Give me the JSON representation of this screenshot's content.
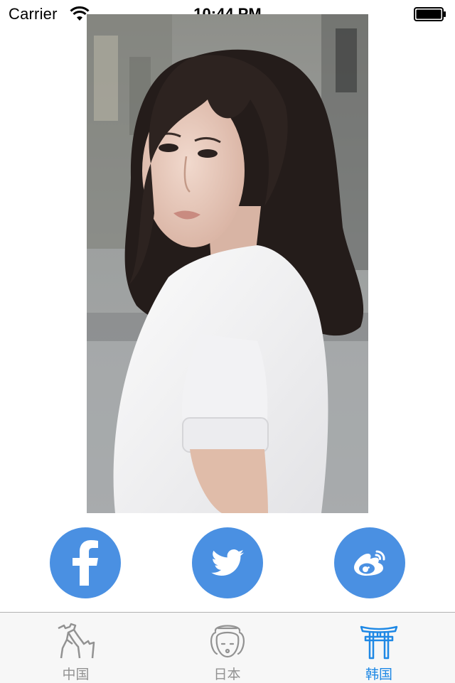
{
  "status_bar": {
    "carrier": "Carrier",
    "time": "10:44 PM"
  },
  "photo": {
    "icon": "portrait-photo"
  },
  "share_buttons": [
    {
      "icon": "facebook-icon"
    },
    {
      "icon": "twitter-icon"
    },
    {
      "icon": "weibo-icon"
    }
  ],
  "tabs": [
    {
      "label": "中国",
      "icon": "great-wall-icon",
      "selected": false
    },
    {
      "label": "日本",
      "icon": "geisha-icon",
      "selected": false
    },
    {
      "label": "韩国",
      "icon": "torii-gate-icon",
      "selected": true
    }
  ],
  "colors": {
    "accent": "#1e88e5",
    "button": "#4a90e2",
    "tab_inactive": "#929292",
    "tabbar_bg": "#f7f7f7"
  }
}
